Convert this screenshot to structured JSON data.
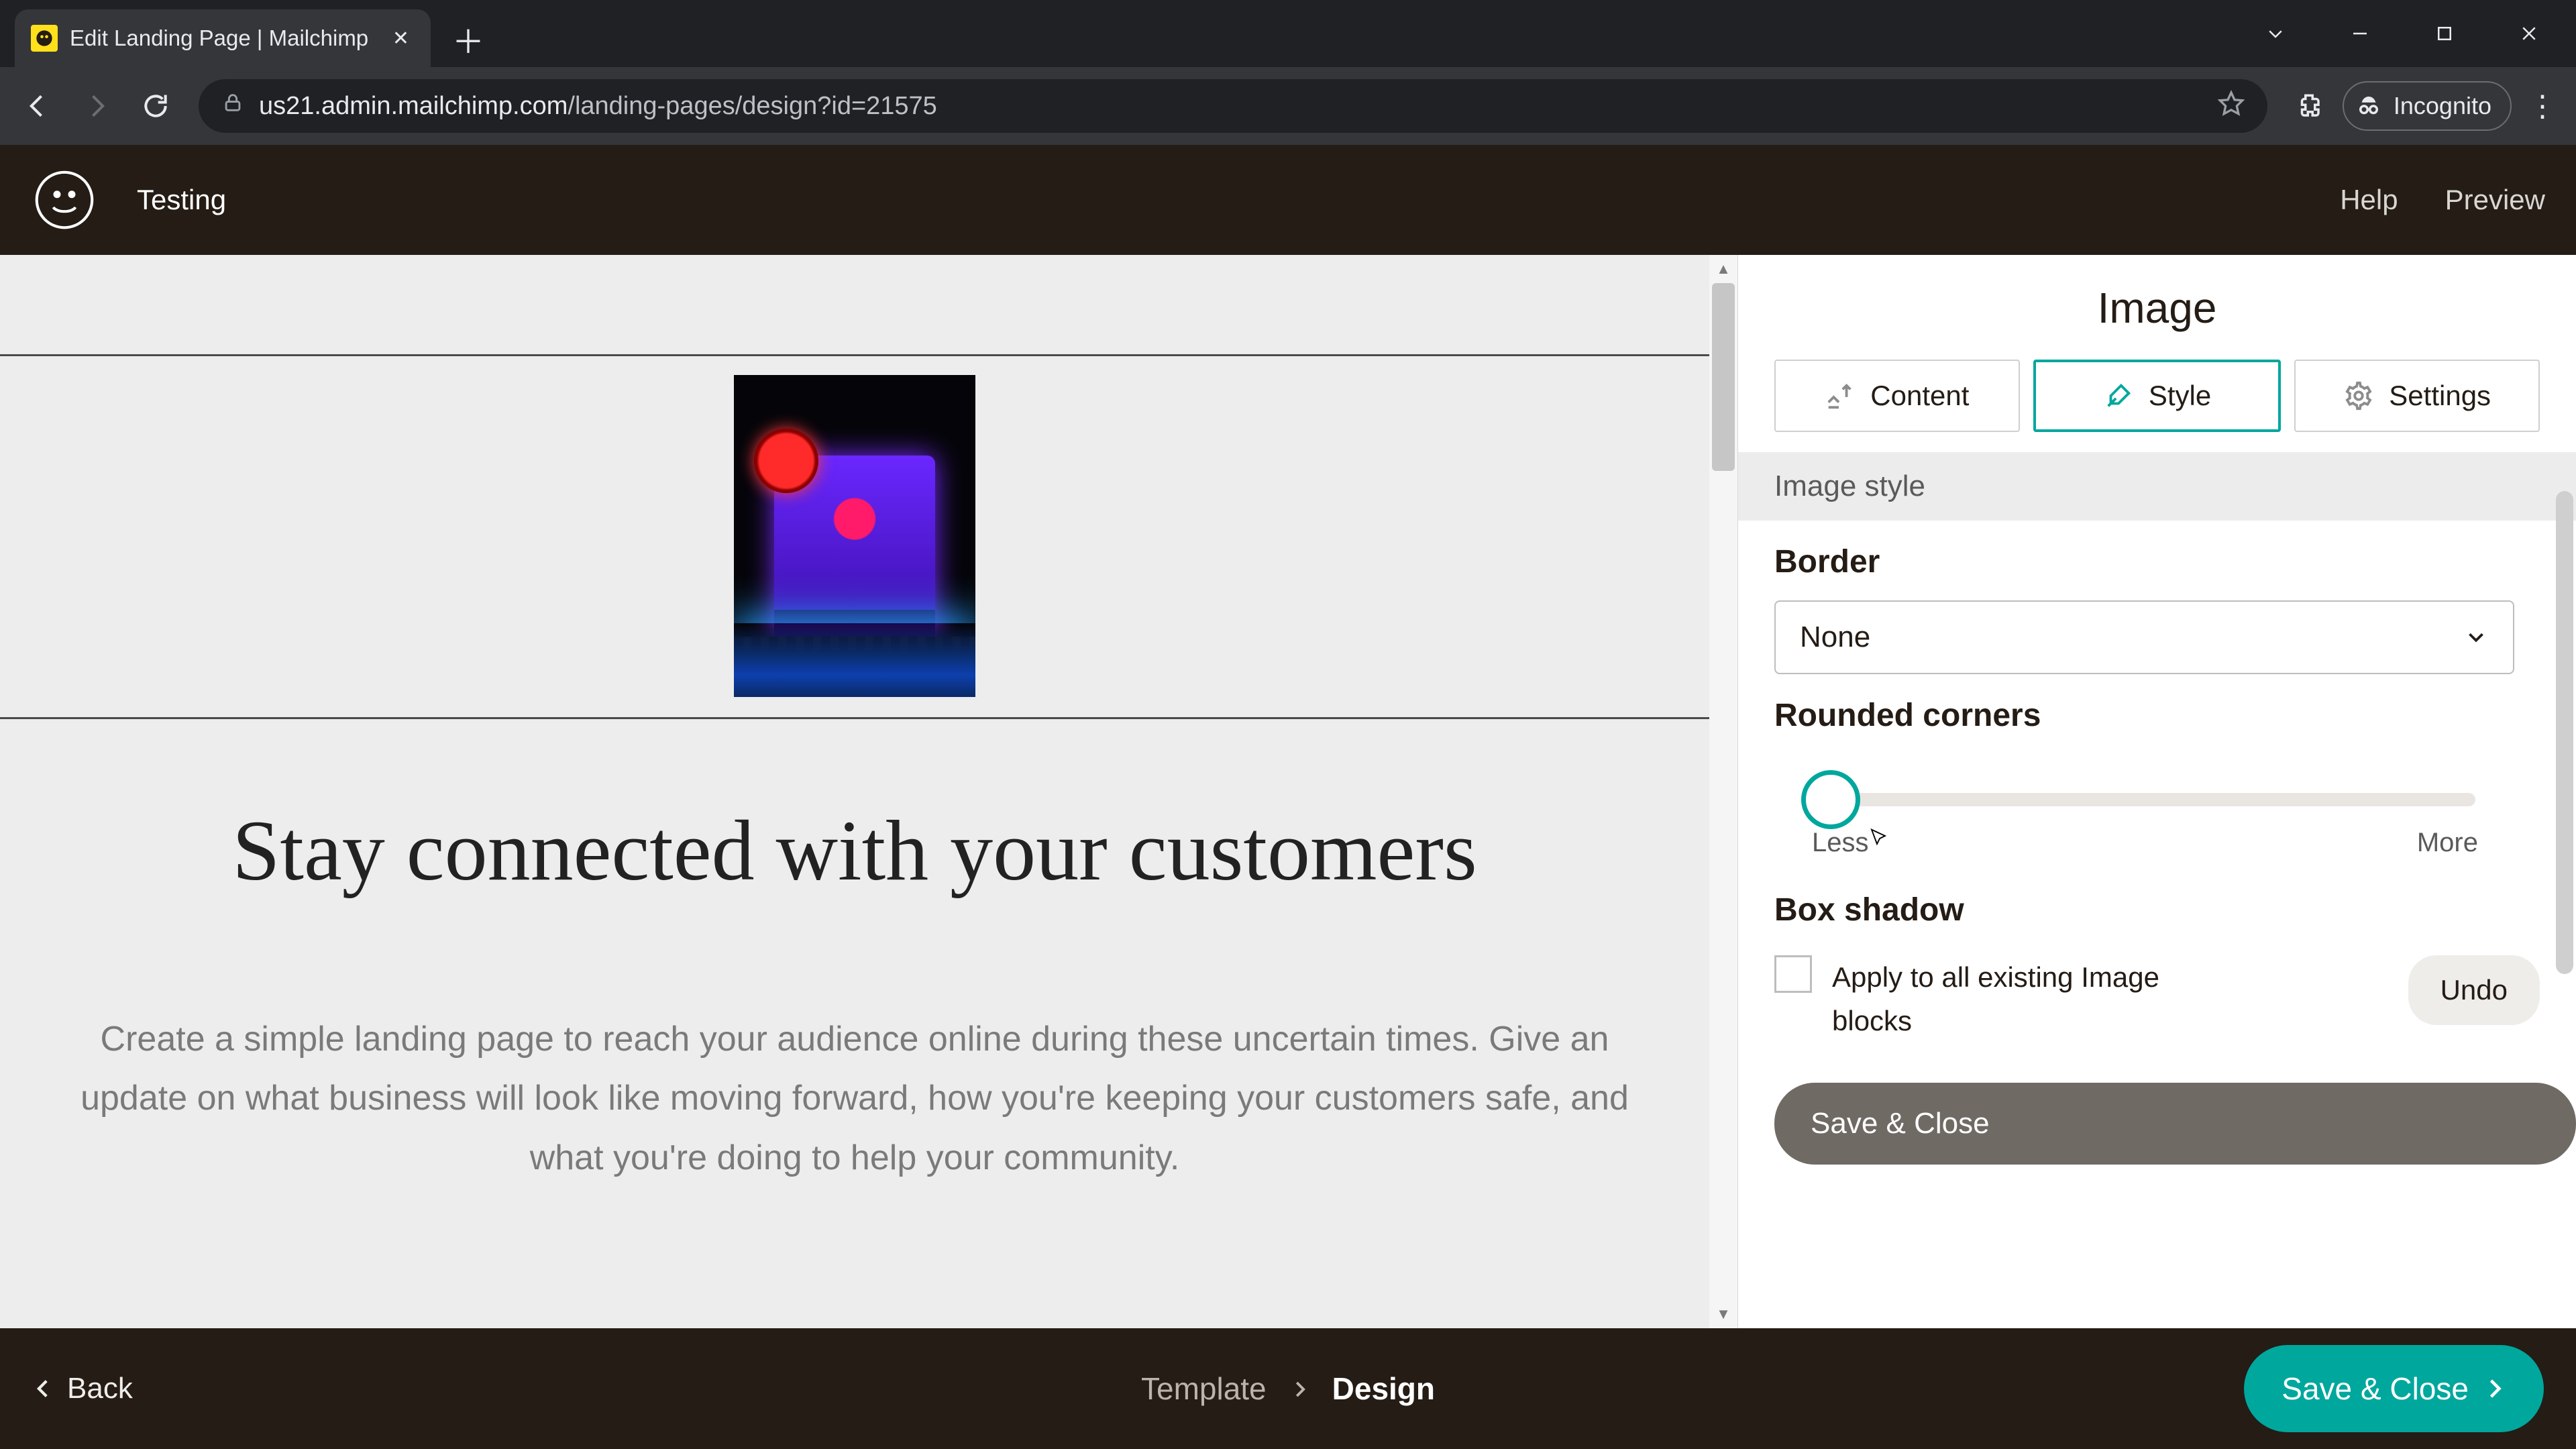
{
  "browser": {
    "tab_title": "Edit Landing Page | Mailchimp",
    "url_host": "us21.admin.mailchimp.com",
    "url_path": "/landing-pages/design?id=21575",
    "incognito_label": "Incognito"
  },
  "header": {
    "doc_title": "Testing",
    "links": {
      "help": "Help",
      "preview": "Preview"
    }
  },
  "canvas": {
    "heading": "Stay connected with your customers",
    "sub": "Create a simple landing page to reach your audience online during these uncertain times. Give an update on what business will look like moving forward, how you're keeping your customers safe, and what you're doing to help your community."
  },
  "panel": {
    "title": "Image",
    "tabs": {
      "content": "Content",
      "style": "Style",
      "settings": "Settings"
    },
    "section_label": "Image style",
    "border_label": "Border",
    "border_value": "None",
    "rounded_label": "Rounded corners",
    "slider_min_label": "Less",
    "slider_max_label": "More",
    "box_shadow_label": "Box shadow",
    "apply_all_label": "Apply to all existing Image blocks",
    "undo_label": "Undo",
    "save_label": "Save & Close"
  },
  "footer": {
    "back_label": "Back",
    "step1": "Template",
    "step2": "Design",
    "save_label": "Save & Close"
  }
}
